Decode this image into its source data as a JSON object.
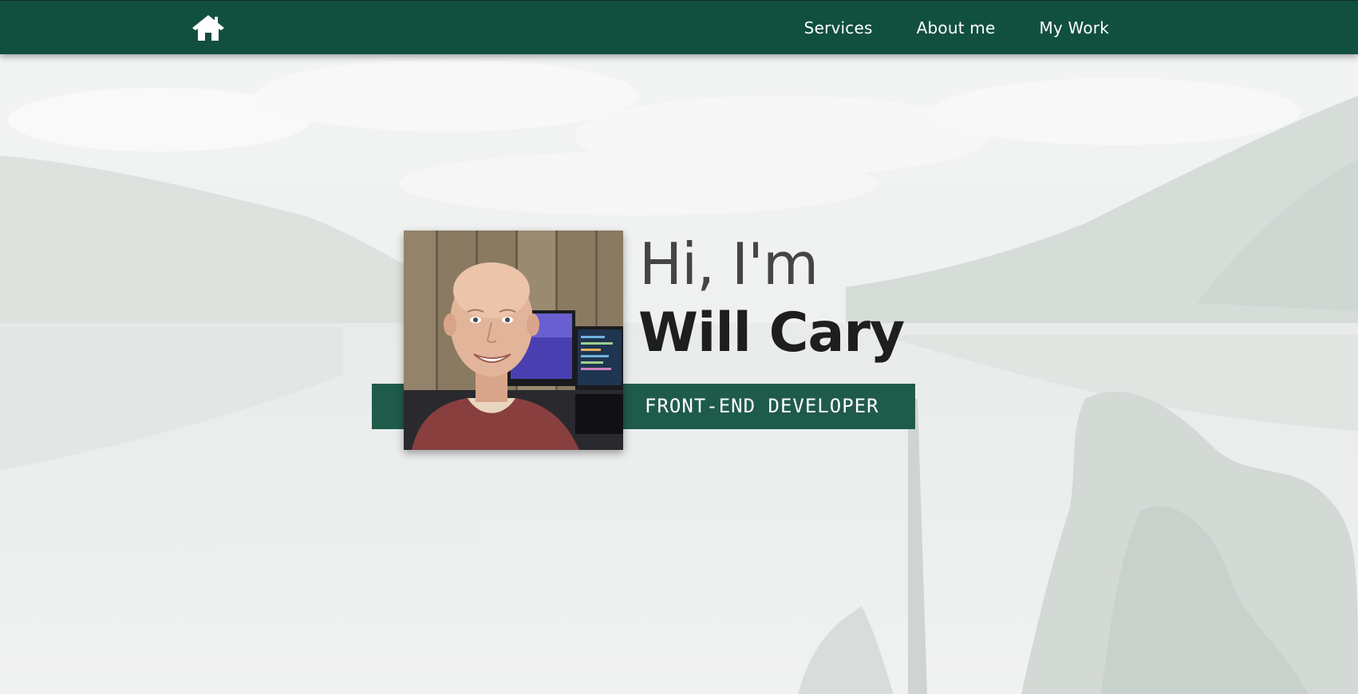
{
  "nav": {
    "home_icon": "home-icon",
    "links": [
      {
        "label": "Services"
      },
      {
        "label": "About me"
      },
      {
        "label": "My Work"
      }
    ]
  },
  "hero": {
    "greeting": "Hi, I'm",
    "name": "Will Cary",
    "role": "FRONT-END DEVELOPER"
  },
  "colors": {
    "nav_bg": "#114f3f",
    "band_bg": "#1f5b4b",
    "text_dark": "#1e1e1e"
  }
}
